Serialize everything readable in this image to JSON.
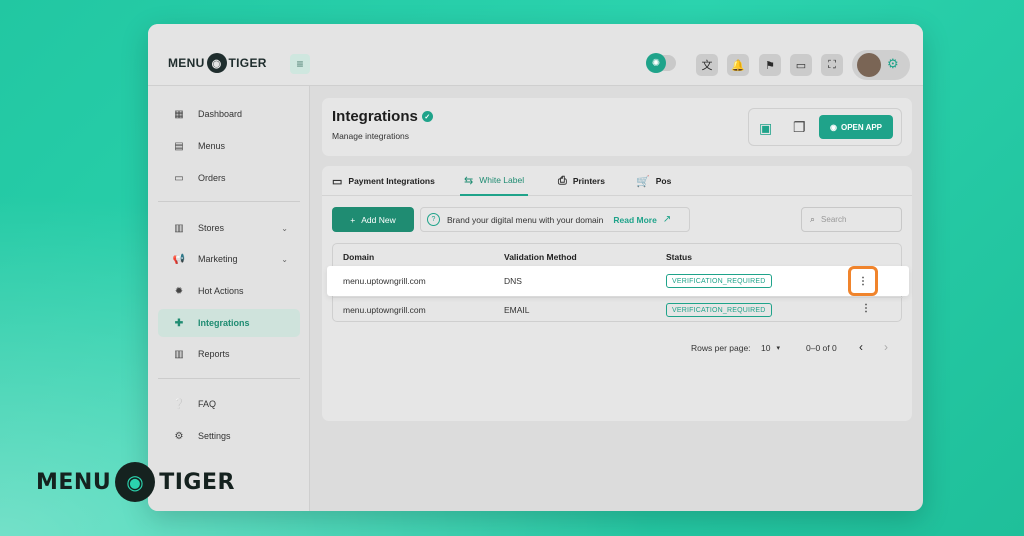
{
  "brand": {
    "left": "MENU",
    "right": "TIGER",
    "tiger_icon": "tiger-icon"
  },
  "topbar": {
    "icons": [
      "translate-icon",
      "bell-icon",
      "flag-icon",
      "devices-icon",
      "fullscreen-icon"
    ],
    "glyphs": {
      "translate": "文",
      "bell": "🔔",
      "flag": "⚑",
      "devices": "▭",
      "fullscreen": "⛶",
      "hamburger": "≡",
      "sun": "✺",
      "cog": "⚙"
    }
  },
  "sidebar": {
    "items": [
      {
        "label": "Dashboard",
        "icon": "▦"
      },
      {
        "label": "Menus",
        "icon": "▤"
      },
      {
        "label": "Orders",
        "icon": "▭"
      },
      {
        "label": "Stores",
        "icon": "▥",
        "chevron": "⌄"
      },
      {
        "label": "Marketing",
        "icon": "📢",
        "chevron": "⌄"
      },
      {
        "label": "Hot Actions",
        "icon": "✹"
      },
      {
        "label": "Integrations",
        "icon": "✚"
      },
      {
        "label": "Reports",
        "icon": "▥"
      },
      {
        "label": "FAQ",
        "icon": "❔"
      },
      {
        "label": "Settings",
        "icon": "⚙"
      }
    ]
  },
  "header": {
    "title": "Integrations",
    "subtitle": "Manage integrations",
    "verified_glyph": "✓",
    "qr_glyph": "▣",
    "copy_glyph": "❐",
    "open_app": {
      "label": "OPEN APP",
      "icon": "◉"
    }
  },
  "tabs": [
    {
      "label": "Payment Integrations",
      "icon": "▭"
    },
    {
      "label": "White Label",
      "icon": "⇆"
    },
    {
      "label": "Printers",
      "icon": "⎙"
    },
    {
      "label": "Pos",
      "icon": "🛒"
    }
  ],
  "toolbar": {
    "add_new": "Add New",
    "plus": "+",
    "brand_text": "Brand your digital menu with your domain",
    "brand_glyph": "?",
    "read_more": "Read More",
    "ext_glyph": "↗",
    "search_placeholder": "Search",
    "search_glyph": "⌕"
  },
  "table": {
    "columns": [
      "Domain",
      "Validation Method",
      "Status"
    ],
    "rows": [
      {
        "domain": "menu.uptowngrill.com",
        "method": "DNS",
        "status": "VERIFICATION_REQUIRED",
        "menu": "⋮"
      },
      {
        "domain": "menu.uptowngrill.com",
        "method": "EMAIL",
        "status": "VERIFICATION_REQUIRED",
        "menu": "⋮"
      }
    ]
  },
  "pagination": {
    "rows_per_page_label": "Rows per page:",
    "rows_per_page_value": "10",
    "range": "0–0 of 0",
    "prev": "‹",
    "next": "›",
    "caret": "▾"
  },
  "colors": {
    "accent": "#1fa38a",
    "highlight": "#f0842c",
    "background": "#2bd3ae"
  }
}
